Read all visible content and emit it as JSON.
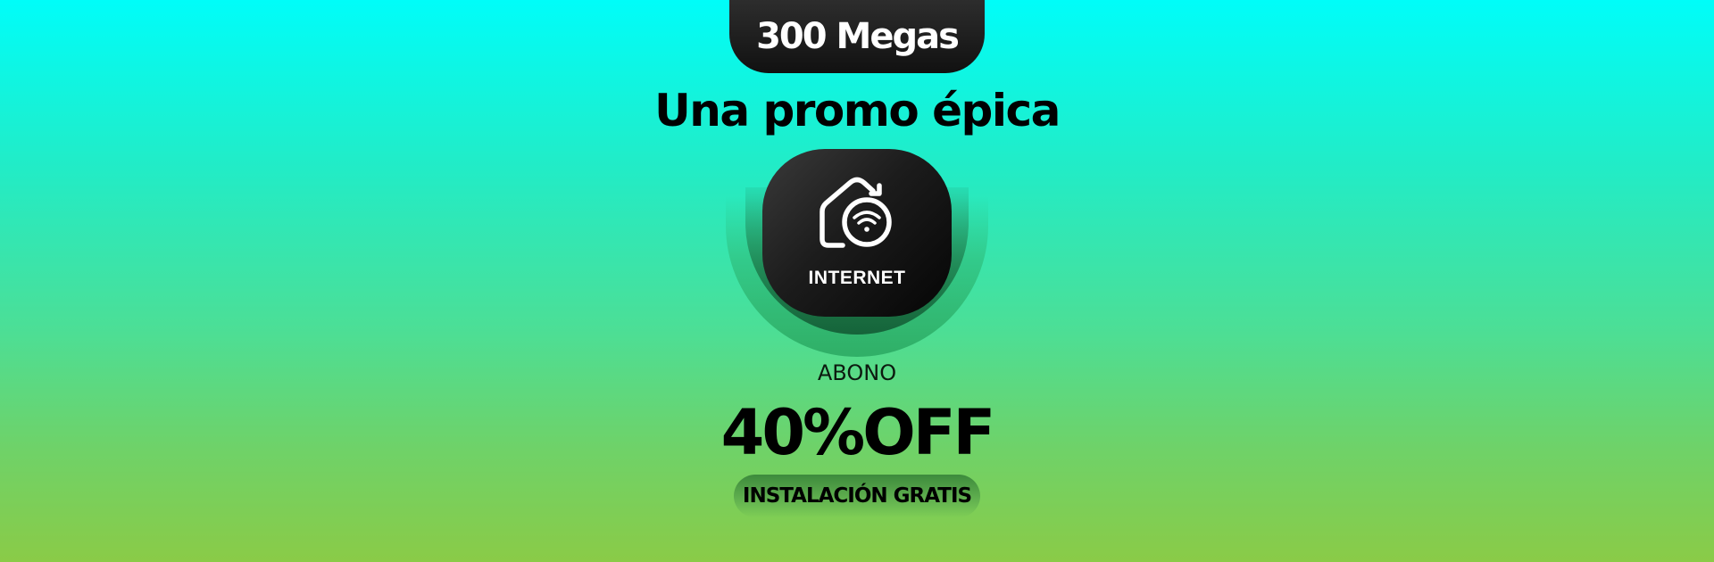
{
  "promo": {
    "speed_label": "300 Megas",
    "headline": "Una promo épica",
    "product_label": "INTERNET",
    "abono_label": "ABONO",
    "discount_label": "40%OFF",
    "install_label": "INSTALACIÓN GRATIS",
    "product_icon": "home-wifi-icon"
  },
  "colors": {
    "background_top": "#00fdf9",
    "background_bottom": "#8acb47",
    "card": "#111111",
    "text_dark": "#000000",
    "text_light": "#ffffff"
  }
}
